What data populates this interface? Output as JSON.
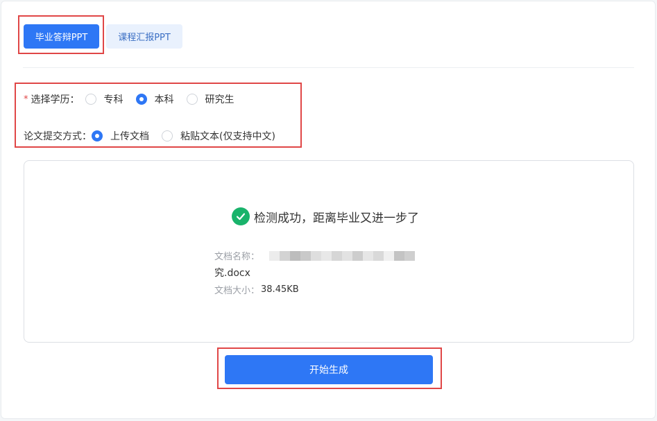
{
  "tabs": {
    "graduation_defense": "毕业答辩PPT",
    "course_report": "课程汇报PPT"
  },
  "form": {
    "education": {
      "required_mark": "*",
      "label": "选择学历：",
      "options": [
        "专科",
        "本科",
        "研究生"
      ],
      "selected": "本科"
    },
    "submit_method": {
      "label": "论文提交方式：",
      "options": [
        "上传文档",
        "粘贴文本(仅支持中文)"
      ],
      "selected": "上传文档"
    }
  },
  "upload": {
    "success_message": "检测成功，距离毕业又进一步了",
    "file_name_label": "文档名称：",
    "file_name_visible": "究.docx",
    "file_size_label": "文档大小：",
    "file_size": "38.45KB"
  },
  "actions": {
    "start_label": "开始生成"
  },
  "colors": {
    "primary": "#2e77f5",
    "success": "#19b36b",
    "annotation": "#e04646"
  }
}
